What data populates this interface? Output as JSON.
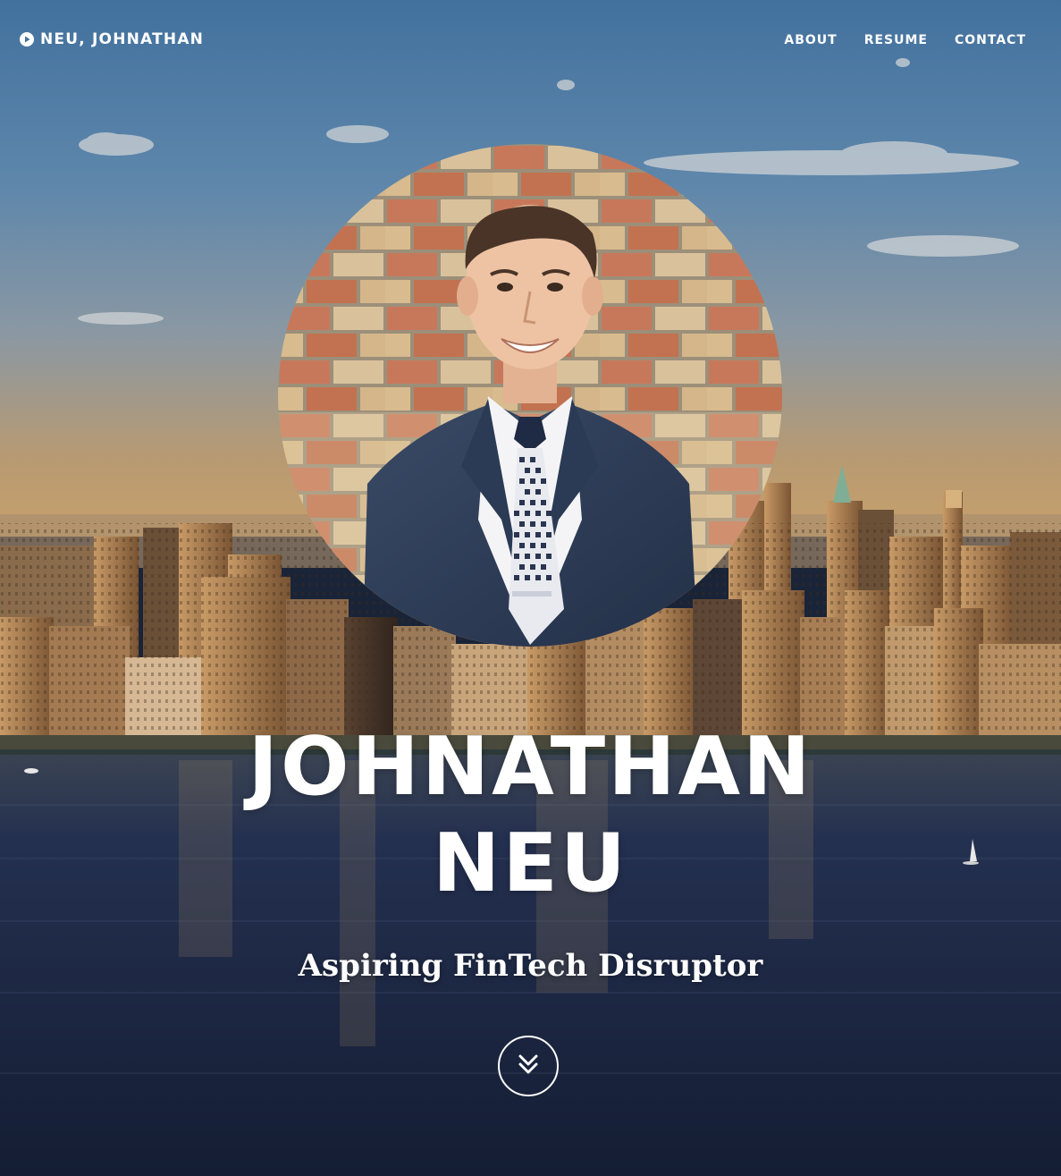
{
  "navbar": {
    "brand_label": "NEU, JOHNATHAN",
    "brand_icon": "play-circle-icon",
    "links": [
      {
        "label": "ABOUT"
      },
      {
        "label": "RESUME"
      },
      {
        "label": "CONTACT"
      }
    ]
  },
  "hero": {
    "title_line_1": "JOHNATHAN",
    "title_line_2": "NEU",
    "subtitle": "Aspiring FinTech Disruptor",
    "scroll_icon": "chevron-double-down-icon"
  },
  "colors": {
    "sky_top": "#4d7aa6",
    "sky_horizon": "#b59468",
    "water": "#1d2a45",
    "text": "#ffffff",
    "brick": "#c77852"
  }
}
